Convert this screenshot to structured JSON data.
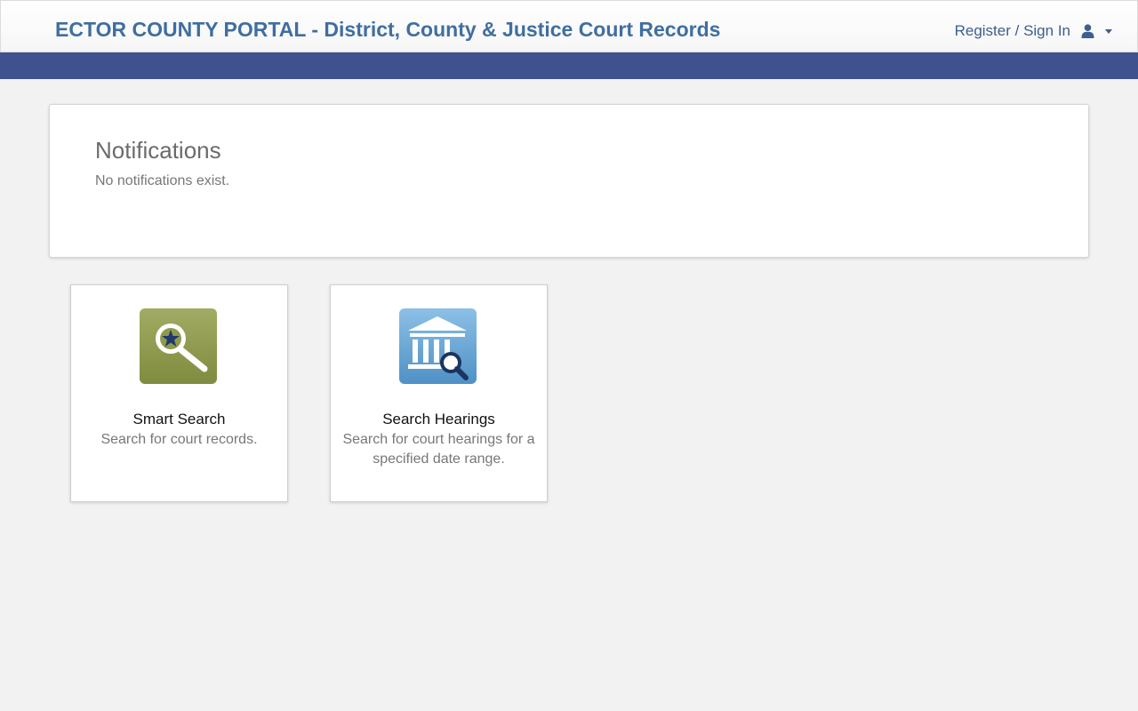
{
  "header": {
    "title": "ECTOR COUNTY PORTAL - District, County & Justice Court Records",
    "signin_label": "Register / Sign In",
    "icons": [
      "user-icon",
      "caret-down-icon"
    ]
  },
  "notifications": {
    "heading": "Notifications",
    "message": "No notifications exist."
  },
  "tiles": [
    {
      "title": "Smart Search",
      "description": "Search for court records.",
      "icon": "smart-search-icon",
      "color": "#8f9a4e"
    },
    {
      "title": "Search Hearings",
      "description": "Search for court hearings for a specified date range.",
      "icon": "courthouse-search-icon",
      "color": "#5e9fd0"
    }
  ],
  "colors": {
    "title_blue": "#3f6ea1",
    "nav_bar": "#3f528f",
    "background": "#f2f2f2"
  }
}
